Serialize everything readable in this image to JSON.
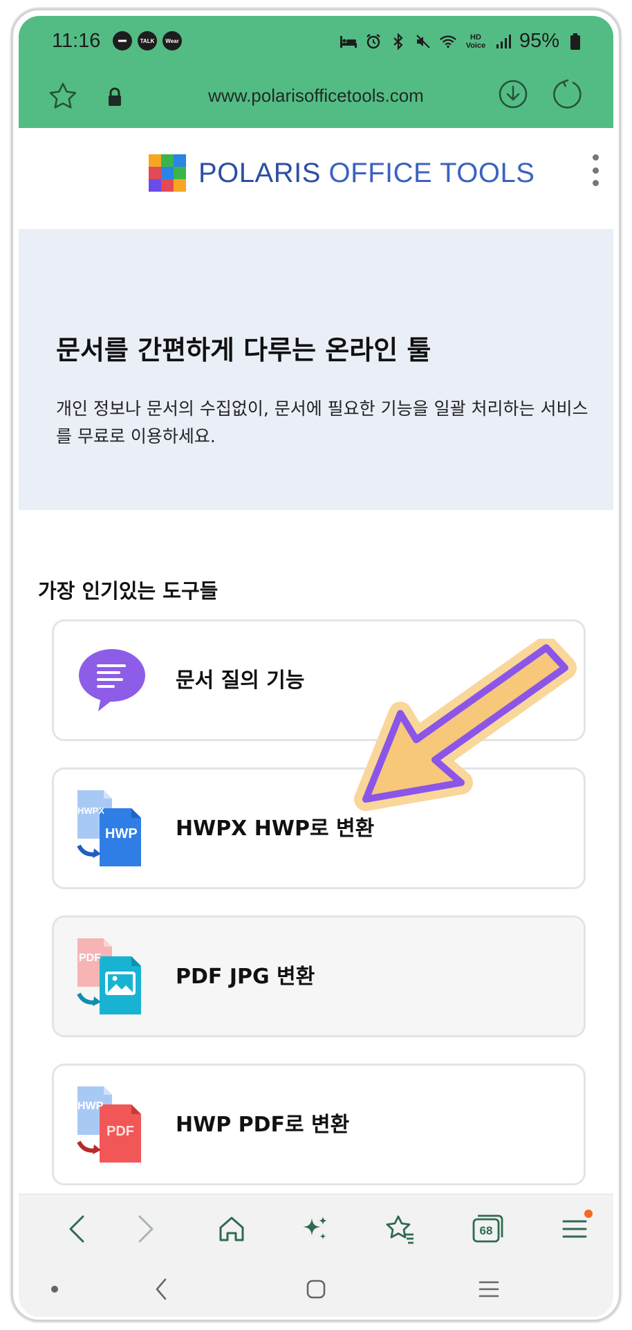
{
  "status_bar": {
    "time": "11:16",
    "app_badges": [
      "TALK",
      "Wear"
    ],
    "network": "HD Voice",
    "battery": "95%"
  },
  "url_bar": {
    "url": "www.polarisofficetools.com"
  },
  "site": {
    "logo_bold": "POLARIS",
    "logo_light": " OFFICE TOOLS"
  },
  "hero": {
    "title": "문서를 간편하게 다루는 온라인 툴",
    "description": "개인 정보나 문서의 수집없이, 문서에 필요한 기능을 일괄 처리하는 서비스를 무료로 이용하세요."
  },
  "tools": {
    "section_title": "가장 인기있는 도구들",
    "items": [
      {
        "label": "문서 질의 기능",
        "icon": "chat-bubble-icon"
      },
      {
        "label": "HWPX HWP로 변환",
        "icon": "hwpx-to-hwp-icon",
        "from_text": "HWPX",
        "to_text": "HWP"
      },
      {
        "label": "PDF JPG 변환",
        "icon": "pdf-to-jpg-icon",
        "from_text": "PDF"
      },
      {
        "label": "HWP PDF로 변환",
        "icon": "hwp-to-pdf-icon",
        "from_text": "HWP",
        "to_text": "PDF"
      }
    ]
  },
  "bottom_bar": {
    "tab_count": "68"
  },
  "colors": {
    "topbar": "#53bc84",
    "hero_bg": "#eaeef7",
    "arrow_fill": "#f7c77a",
    "arrow_stroke": "#8b55e8",
    "logo_blue": "#2d4ea3"
  }
}
